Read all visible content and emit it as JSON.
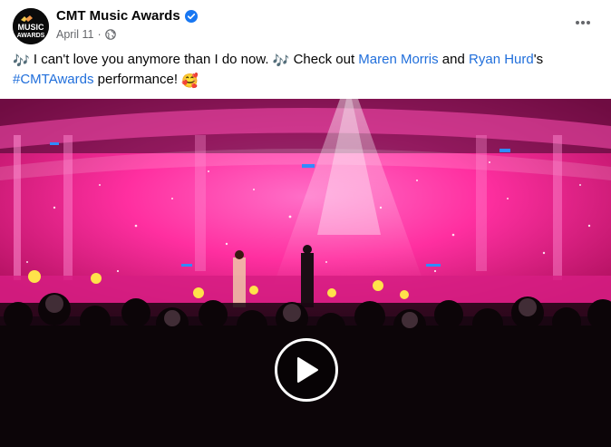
{
  "post": {
    "page_name": "CMT Music Awards",
    "date": "April 11",
    "separator": "·",
    "avatar_logo_text": [
      "MUSIC",
      "AWARDS"
    ],
    "message": {
      "emoji_notes": "🎶",
      "part1": " I can't love you anymore than I do now. ",
      "part2": " Check out ",
      "mention1": "Maren Morris",
      "and_text": " and ",
      "mention2": "Ryan Hurd",
      "possessive": "'s",
      "hashtag": "#CMTAwards",
      "part3": " performance! ",
      "emoji_love": "🥰"
    }
  },
  "icons": {
    "verified": "verified-badge-icon",
    "audience": "globe-icon",
    "more": "more-options-icon",
    "play": "play-icon"
  },
  "colors": {
    "link": "#216fdb",
    "verified": "#1877f2",
    "secondary_text": "#65676b",
    "stage_pink": "#ff2fa0"
  }
}
